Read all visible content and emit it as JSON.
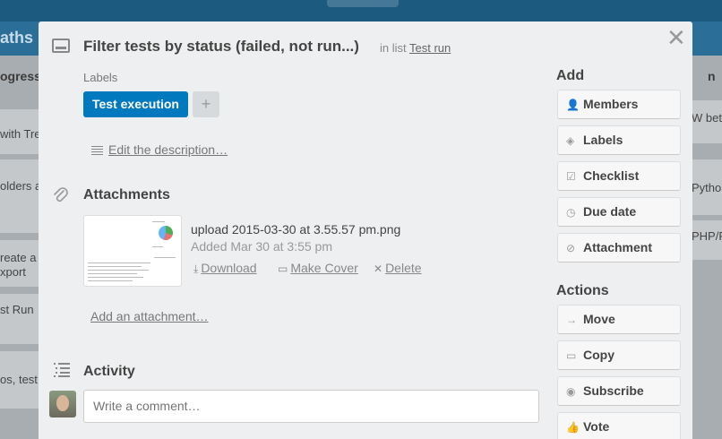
{
  "board": {
    "title": "aths",
    "left_list_title": "ogress",
    "left_cards": [
      "with Trel",
      "olders a",
      "reate a",
      "xport",
      "st Run",
      "os, test"
    ],
    "right_list_title": "n",
    "right_cards": [
      "W bet",
      "Pytho",
      "PHP/P"
    ]
  },
  "card": {
    "title": "Filter tests by status (failed, not run...)",
    "in_list_prefix": "in list",
    "list_name": "Test run"
  },
  "labels": {
    "caption": "Labels",
    "items": [
      "Test execution"
    ],
    "add_glyph": "+",
    "label_color": "#0079bf"
  },
  "description": {
    "edit_link": "Edit the description…"
  },
  "attachments": {
    "title": "Attachments",
    "file_name": "upload 2015-03-30 at 3.55.57 pm.png",
    "added": "Added Mar 30 at 3:55 pm",
    "download": "Download",
    "make_cover": "Make Cover",
    "delete": "Delete",
    "add_link": "Add an attachment…"
  },
  "activity": {
    "title": "Activity",
    "comment_placeholder": "Write a comment…"
  },
  "sidebar": {
    "add_heading": "Add",
    "add_buttons": [
      {
        "label": "Members",
        "icon": "person-icon"
      },
      {
        "label": "Labels",
        "icon": "tag-icon"
      },
      {
        "label": "Checklist",
        "icon": "checkbox-icon"
      },
      {
        "label": "Due date",
        "icon": "clock-icon"
      },
      {
        "label": "Attachment",
        "icon": "paperclip-icon"
      }
    ],
    "actions_heading": "Actions",
    "action_buttons": [
      {
        "label": "Move",
        "icon": "arrow-right-icon"
      },
      {
        "label": "Copy",
        "icon": "card-icon"
      },
      {
        "label": "Subscribe",
        "icon": "eye-icon"
      },
      {
        "label": "Vote",
        "icon": "thumbs-up-icon"
      }
    ]
  },
  "close_glyph": "✕"
}
